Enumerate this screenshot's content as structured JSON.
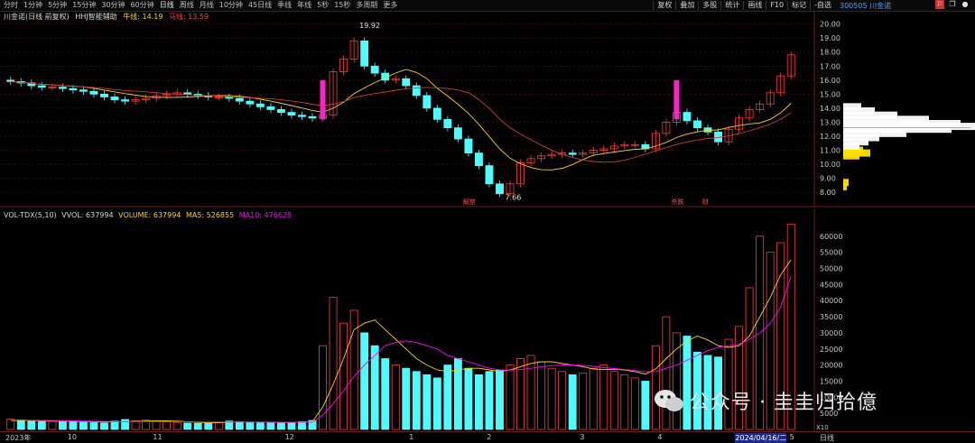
{
  "toolbar": {
    "tabs": [
      "分时",
      "1分钟",
      "5分钟",
      "15分钟",
      "30分钟",
      "60分钟",
      "日线",
      "周线",
      "月线",
      "10分钟",
      "45日线",
      "季线",
      "年线",
      "5秒",
      "15秒",
      "多周期",
      "更多"
    ],
    "active_tab": "日线",
    "tools": [
      "复权",
      "叠加",
      "多股",
      "统计",
      "画线",
      "F10",
      "标记",
      "-自选"
    ],
    "stock_code": "300505 川金诺"
  },
  "price_panel": {
    "title": "川金诺(日线 前复权)",
    "indicator": "HHJ智能辅助",
    "bull_line_label": "牛线: 14.19",
    "horse_line_label": "马线: 13.59",
    "y_ticks": [
      "20.00",
      "19.00",
      "18.00",
      "17.00",
      "16.00",
      "15.00",
      "14.00",
      "13.00",
      "12.00",
      "11.00",
      "10.00",
      "9.00",
      "8.00"
    ],
    "high_label": "19.92",
    "low_label": "7.66",
    "event_tags": [
      "解禁",
      "杀跌",
      "财"
    ]
  },
  "volume_panel": {
    "legend": {
      "name": "VOL-TDX(5,10)",
      "vvol": "VVOL: 637994",
      "volume": "VOLUME: 637994",
      "ma5": "MA5: 526855",
      "ma10": "MA10: 476628"
    },
    "y_ticks": [
      "60000",
      "55000",
      "50000",
      "45000",
      "40000",
      "35000",
      "30000",
      "25000",
      "20000",
      "15000",
      "10000",
      "5000"
    ],
    "unit": "X10"
  },
  "x_axis": {
    "labels": [
      "2023年",
      "10",
      "11",
      "12",
      "1",
      "2",
      "3",
      "4",
      "2024/04/16/二",
      "5"
    ],
    "period": "日线"
  },
  "watermark": {
    "text": "公众号 · 圭圭归拾億"
  },
  "colors": {
    "up": "#ff3b3b",
    "down": "#4dfcff",
    "ma_fast": "#ffd400",
    "ma_slow": "#ff00ff",
    "grid": "#5a0f0f",
    "profile": "#ffffff",
    "profile_highlight": "#ffe000"
  },
  "chart_data": {
    "type": "candlestick",
    "price_close": [
      15.9,
      15.8,
      15.6,
      15.5,
      15.5,
      15.4,
      15.3,
      15.2,
      15.0,
      14.8,
      14.6,
      14.5,
      14.6,
      14.7,
      14.9,
      15.0,
      15.1,
      15.0,
      14.9,
      14.8,
      14.8,
      14.7,
      14.5,
      14.3,
      14.1,
      13.9,
      13.7,
      13.5,
      13.4,
      13.3,
      13.5,
      16.6,
      17.5,
      18.8,
      17.0,
      16.5,
      16.0,
      16.1,
      15.6,
      14.9,
      14.0,
      13.2,
      12.6,
      11.8,
      10.8,
      9.9,
      8.6,
      7.9,
      8.6,
      10.1,
      10.4,
      10.6,
      10.7,
      10.8,
      10.7,
      10.8,
      11.0,
      11.1,
      11.3,
      11.4,
      11.4,
      11.1,
      12.2,
      13.0,
      13.7,
      13.1,
      12.6,
      12.3,
      11.6,
      12.5,
      13.3,
      13.9,
      14.3,
      15.1,
      16.3,
      17.8
    ],
    "volume": [
      3200,
      3000,
      2800,
      2500,
      2600,
      2400,
      2300,
      2200,
      2100,
      2000,
      2600,
      3100,
      2700,
      2900,
      2500,
      2400,
      2200,
      2000,
      1900,
      2100,
      2300,
      2600,
      2400,
      2200,
      2100,
      2300,
      2000,
      2100,
      2400,
      2800,
      26000,
      41000,
      33000,
      37000,
      30000,
      26000,
      22000,
      20000,
      19000,
      18000,
      17000,
      16000,
      20000,
      22000,
      19000,
      17000,
      18000,
      18500,
      20000,
      22000,
      23000,
      21000,
      19000,
      18000,
      17000,
      17500,
      19000,
      20000,
      18000,
      17000,
      16000,
      15000,
      26000,
      35000,
      30000,
      29000,
      24000,
      23000,
      22500,
      28000,
      32000,
      44000,
      60000,
      55000,
      58000,
      63800
    ],
    "ma5": [
      2800,
      2800,
      2750,
      2700,
      2600,
      2550,
      2500,
      2450,
      2400,
      2300,
      2350,
      2450,
      2500,
      2600,
      2650,
      2700,
      2600,
      2400,
      2250,
      2100,
      2100,
      2200,
      2300,
      2300,
      2300,
      2250,
      2150,
      2150,
      2200,
      2350,
      7000,
      14000,
      22000,
      31000,
      33000,
      34000,
      31000,
      28000,
      25000,
      22000,
      20000,
      18500,
      18000,
      18500,
      19000,
      19000,
      18500,
      18000,
      18500,
      19500,
      20500,
      21000,
      21000,
      20500,
      20000,
      19500,
      18800,
      18600,
      18700,
      18500,
      18000,
      17200,
      18800,
      22000,
      25000,
      27500,
      29000,
      27800,
      26000,
      25500,
      26000,
      29000,
      35000,
      41000,
      48000,
      52700
    ],
    "ma10": [
      2900,
      2900,
      2850,
      2800,
      2750,
      2700,
      2650,
      2600,
      2550,
      2500,
      2450,
      2450,
      2450,
      2450,
      2450,
      2450,
      2450,
      2400,
      2350,
      2300,
      2300,
      2300,
      2300,
      2300,
      2280,
      2250,
      2220,
      2200,
      2200,
      2220,
      4500,
      8000,
      12000,
      16500,
      20000,
      23000,
      26000,
      27000,
      27500,
      27000,
      26000,
      25000,
      23000,
      22000,
      21000,
      20000,
      19000,
      18500,
      18400,
      18600,
      19000,
      19500,
      19800,
      20000,
      20000,
      19900,
      19600,
      19200,
      18900,
      18600,
      18300,
      17900,
      18000,
      19000,
      20000,
      21500,
      23000,
      24500,
      25500,
      26000,
      26500,
      28000,
      30000,
      33000,
      38000,
      47600
    ]
  }
}
